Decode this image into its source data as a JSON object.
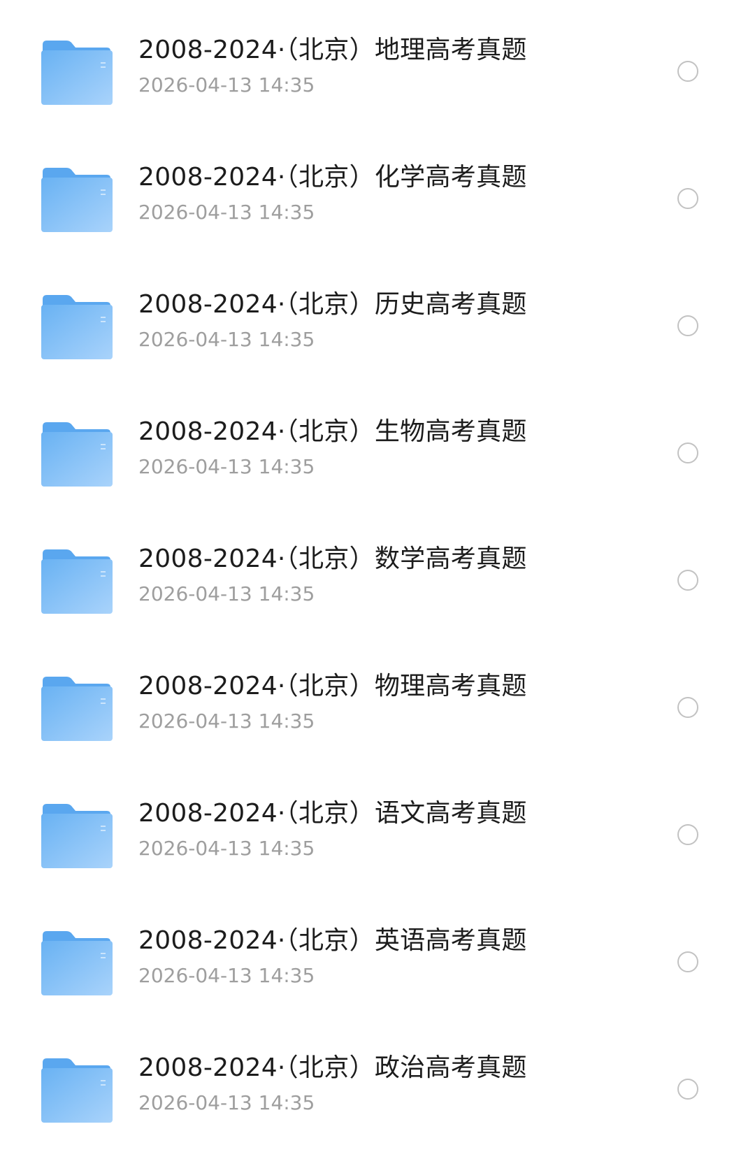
{
  "files": [
    {
      "name": "2008-2024·（北京）地理高考真题",
      "modified": "2026-04-13 14:35",
      "icon": "folder-icon"
    },
    {
      "name": "2008-2024·（北京）化学高考真题",
      "modified": "2026-04-13 14:35",
      "icon": "folder-icon"
    },
    {
      "name": "2008-2024·（北京）历史高考真题",
      "modified": "2026-04-13 14:35",
      "icon": "folder-icon"
    },
    {
      "name": "2008-2024·（北京）生物高考真题",
      "modified": "2026-04-13 14:35",
      "icon": "folder-icon"
    },
    {
      "name": "2008-2024·（北京）数学高考真题",
      "modified": "2026-04-13 14:35",
      "icon": "folder-icon"
    },
    {
      "name": "2008-2024·（北京）物理高考真题",
      "modified": "2026-04-13 14:35",
      "icon": "folder-icon"
    },
    {
      "name": "2008-2024·（北京）语文高考真题",
      "modified": "2026-04-13 14:35",
      "icon": "folder-icon"
    },
    {
      "name": "2008-2024·（北京）英语高考真题",
      "modified": "2026-04-13 14:35",
      "icon": "folder-icon"
    },
    {
      "name": "2008-2024·（北京）政治高考真题",
      "modified": "2026-04-13 14:35",
      "icon": "folder-icon"
    }
  ],
  "colors": {
    "folder_back": "#5aa7ef",
    "folder_front_top": "#69b2f3",
    "folder_front_bottom": "#a9d3fb",
    "title_text": "#1c1c1c",
    "time_text": "#9e9e9e",
    "radio_border": "#c2c2c2"
  }
}
